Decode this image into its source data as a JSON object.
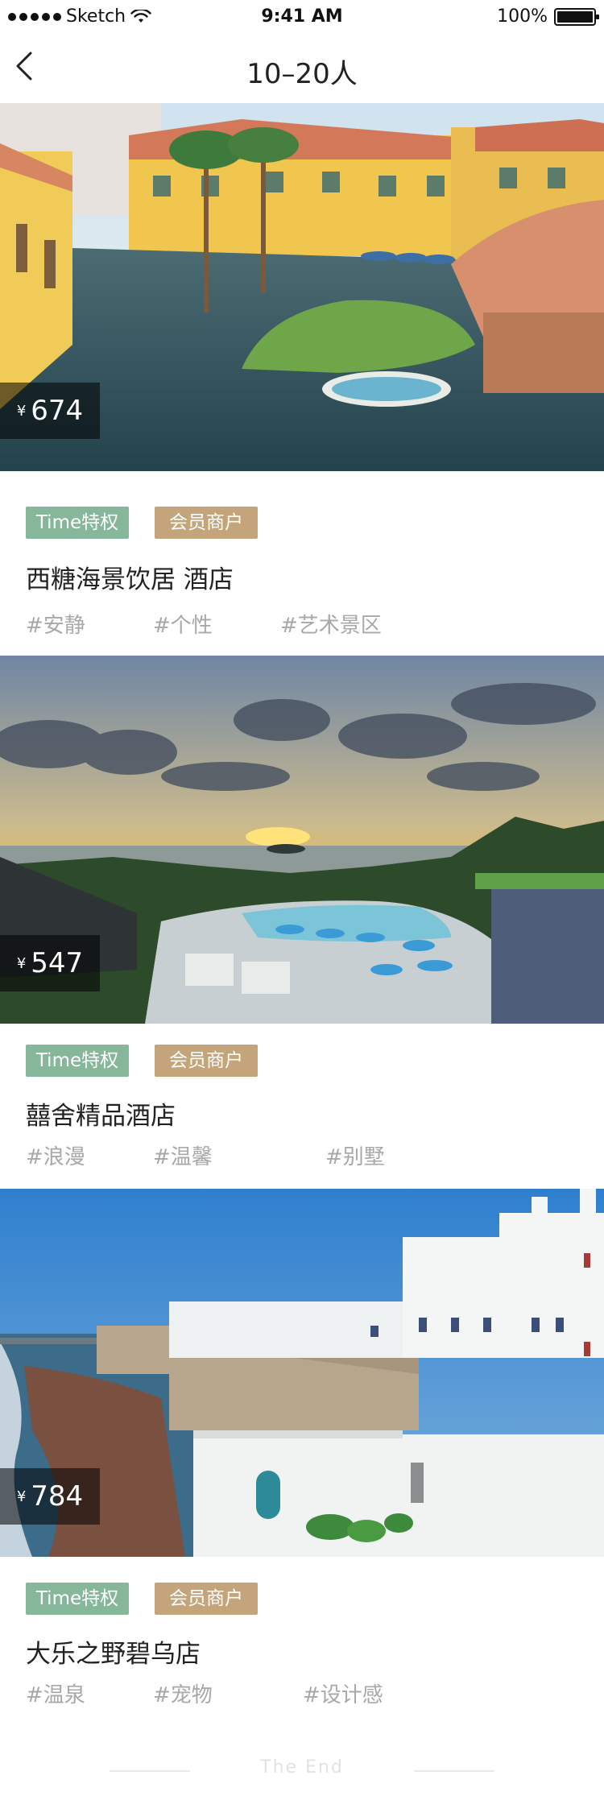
{
  "status_bar": {
    "carrier": "Sketch",
    "time": "9:41 AM",
    "battery": "100%"
  },
  "nav": {
    "title": "10–20人"
  },
  "cards": [
    {
      "price_currency": "¥",
      "price": "674",
      "badge_time": "Time特权",
      "badge_member": "会员商户",
      "name": "西糖海景饮居  酒店",
      "tags": [
        "#安静",
        "#个性",
        "#艺术景区"
      ]
    },
    {
      "price_currency": "¥",
      "price": "547",
      "badge_time": "Time特权",
      "badge_member": "会员商户",
      "name": "囍舍精品酒店",
      "tags": [
        "#浪漫",
        "#温馨",
        "#别墅"
      ]
    },
    {
      "price_currency": "¥",
      "price": "784",
      "badge_time": "Time特权",
      "badge_member": "会员商户",
      "name": "大乐之野碧乌店",
      "tags": [
        "#温泉",
        "#宠物",
        "#设计感"
      ]
    }
  ],
  "footer": {
    "end_text": "The   End"
  }
}
